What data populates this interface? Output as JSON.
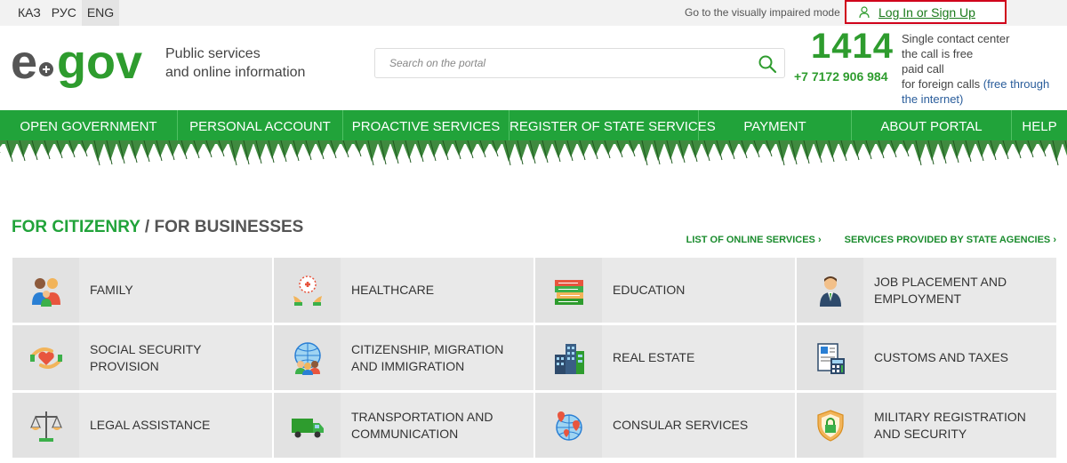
{
  "topbar": {
    "languages": [
      "КАЗ",
      "РУС",
      "ENG"
    ],
    "impaired_link": "Go to the visually impaired mode",
    "login": "Log In or Sign Up"
  },
  "header": {
    "logo_alt": "e-gov",
    "tagline_line1": "Public services",
    "tagline_line2": "and online information",
    "search_placeholder": "Search on the portal",
    "contact_number": "1414",
    "phone": "+7 7172 906 984",
    "contact_line1": "Single contact center",
    "contact_line2": "the call is free",
    "contact_line3": "paid call",
    "contact_line4": "for foreign calls",
    "contact_free_link": "(free through the internet)"
  },
  "nav": {
    "items": [
      "OPEN GOVERNMENT",
      "PERSONAL ACCOUNT",
      "PROACTIVE SERVICES",
      "REGISTER OF STATE SERVICES",
      "PAYMENT",
      "ABOUT PORTAL",
      "HELP"
    ]
  },
  "section": {
    "title_active": "FOR CITIZENRY",
    "title_separator": " / ",
    "title_other": "FOR BUSINESSES",
    "link_online": "LIST OF ONLINE SERVICES ›",
    "link_agencies": "SERVICES PROVIDED BY STATE AGENCIES ›"
  },
  "categories": [
    {
      "label": "FAMILY",
      "icon": "family-icon"
    },
    {
      "label": "HEALTHCARE",
      "icon": "healthcare-icon"
    },
    {
      "label": "EDUCATION",
      "icon": "books-icon"
    },
    {
      "label": "JOB PLACEMENT AND EMPLOYMENT",
      "icon": "businessman-icon"
    },
    {
      "label": "SOCIAL SECURITY PROVISION",
      "icon": "heart-hands-icon"
    },
    {
      "label": "CITIZENSHIP, MIGRATION AND IMMIGRATION",
      "icon": "globe-people-icon"
    },
    {
      "label": "REAL ESTATE",
      "icon": "buildings-icon"
    },
    {
      "label": "CUSTOMS AND TAXES",
      "icon": "calculator-icon"
    },
    {
      "label": "LEGAL ASSISTANCE",
      "icon": "scales-icon"
    },
    {
      "label": "TRANSPORTATION AND COMMUNICATION",
      "icon": "truck-icon"
    },
    {
      "label": "CONSULAR SERVICES",
      "icon": "globe-pins-icon"
    },
    {
      "label": "MILITARY REGISTRATION AND SECURITY",
      "icon": "shield-lock-icon"
    }
  ],
  "colors": {
    "brand_green": "#21a33a",
    "logo_green": "#2e9c2e",
    "login_border": "#d0021b"
  }
}
